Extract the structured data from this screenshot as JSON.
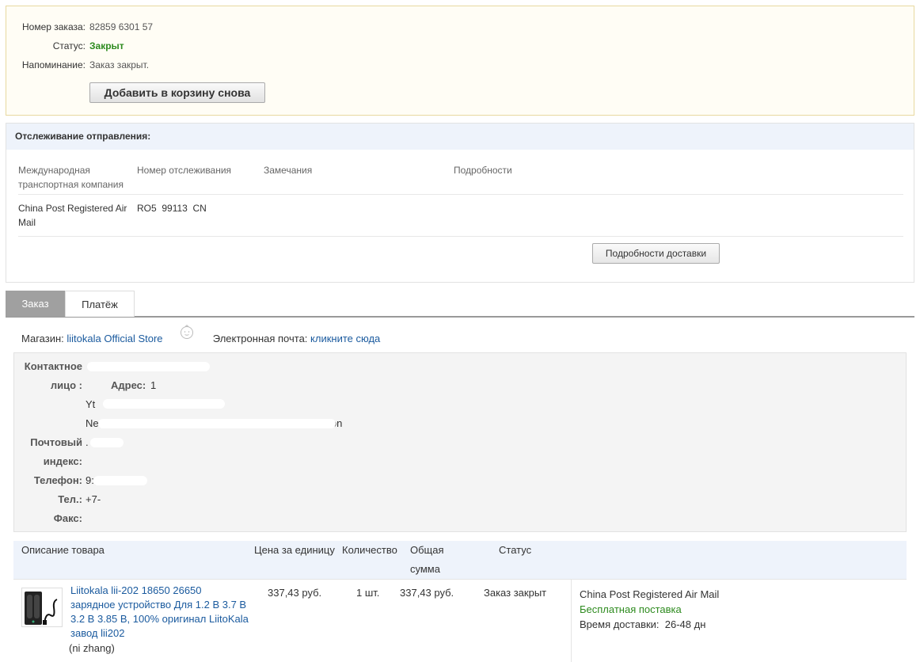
{
  "order": {
    "number_label": "Номер заказа:",
    "number_value": "82859    6301 57",
    "status_label": "Статус:",
    "status_value": "Закрыт",
    "reminder_label": "Напоминание:",
    "reminder_value": "Заказ закрыт.",
    "reorder_button": "Добавить в корзину снова"
  },
  "tracking": {
    "title": "Отслеживание отправления:",
    "col_carrier_line1": "Международная",
    "col_carrier_line2": "транспортная компания",
    "col_number": "Номер отслеживания",
    "col_remarks": "Замечания",
    "col_details": "Подробности",
    "carrier_line1": "China Post Registered Air",
    "carrier_line2": "Mail",
    "tracking_number": "RO5  99113  CN",
    "delivery_button": "Подробности доставки"
  },
  "tabs": [
    {
      "label": "Заказ",
      "active": true
    },
    {
      "label": "Платёж",
      "active": false
    }
  ],
  "store": {
    "label": "Магазин:",
    "name": "liitokala Official Store",
    "email_label": "Электронная почта:",
    "email_link": "кликните сюда"
  },
  "address": {
    "contact_label_1": "Контактное",
    "contact_label_2": "лицо :",
    "address_label": "Адрес:",
    "address_value": "1",
    "address_line2": "Yt    N",
    "address_line3": "Ne                                                                    Federation",
    "postal_label_1": "Почтовый",
    "postal_label_2": "индекс:",
    "postal_value": ".",
    "phone_label": "Телефон:",
    "phone_value": "9:      .",
    "tel_label": "Тел.:",
    "tel_value": "+7-",
    "fax_label": "Факс:",
    "fax_value": ""
  },
  "items_table": {
    "col_description": "Описание товара",
    "col_unit_price": "Цена за единицу",
    "col_quantity": "Количество",
    "col_total_1": "Общая",
    "col_total_2": "сумма",
    "col_status": "Статус",
    "items": [
      {
        "title": "Liitokala lii-202 18650 26650 зарядное устройство Для 1.2 В 3.7 В 3.2 В 3.85 В, 100% оригинал LiitoKala завод lii202",
        "variant": "(ni zhang)",
        "unit_price": "337,43 руб.",
        "quantity": "1 шт.",
        "total": "337,43 руб.",
        "status": "Заказ закрыт",
        "shipping_method": "China Post Registered Air Mail",
        "shipping_cost": "Бесплатная поставка",
        "delivery_time": "Время доставки:  26-48 дн"
      }
    ]
  },
  "colors": {
    "status_green": "#2e8b1f",
    "link_blue": "#1a5a9e",
    "header_blue_bg": "#eef3fb",
    "tab_active_bg": "#a0a0a0"
  }
}
